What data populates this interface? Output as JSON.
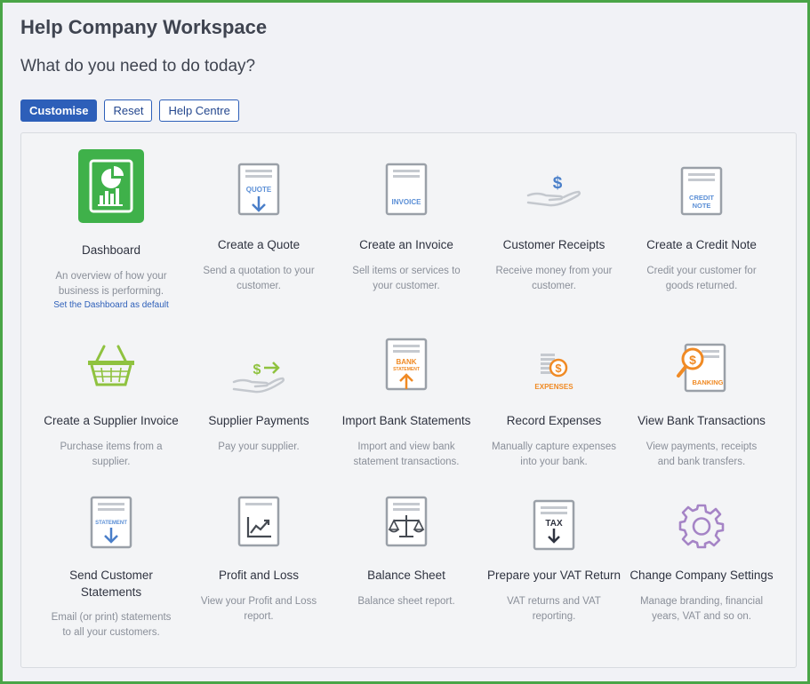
{
  "header": {
    "title": "Help Company Workspace",
    "subtitle": "What do you need to do today?"
  },
  "toolbar": {
    "customise": "Customise",
    "reset": "Reset",
    "help_centre": "Help Centre"
  },
  "colors": {
    "accent": "#2d5fb9",
    "brand_green": "#3fb14a",
    "icon_grey": "#6c6f77",
    "icon_blue": "#5b8fd6",
    "icon_orange": "#f08a24",
    "icon_lime": "#8fc23f",
    "icon_purple": "#a584c6"
  },
  "tiles": [
    {
      "label": "Dashboard",
      "desc": "An overview of how your business is performing.",
      "link": "Set the Dashboard as default",
      "icon": "dashboard-icon"
    },
    {
      "label": "Create a Quote",
      "desc": "Send a quotation to your customer.",
      "icon": "quote-icon",
      "icon_text": "QUOTE"
    },
    {
      "label": "Create an Invoice",
      "desc": "Sell items or services to your customer.",
      "icon": "invoice-icon",
      "icon_text": "INVOICE"
    },
    {
      "label": "Customer Receipts",
      "desc": "Receive money from your customer.",
      "icon": "customer-receipt-icon",
      "icon_text": "$"
    },
    {
      "label": "Create a Credit Note",
      "desc": "Credit your customer for goods returned.",
      "icon": "credit-note-icon",
      "icon_text": "CREDIT NOTE"
    },
    {
      "label": "Create a Supplier Invoice",
      "desc": "Purchase items from a supplier.",
      "icon": "basket-icon"
    },
    {
      "label": "Supplier Payments",
      "desc": "Pay your supplier.",
      "icon": "supplier-payment-icon",
      "icon_text": "$"
    },
    {
      "label": "Import Bank Statements",
      "desc": "Import and view bank statement transactions.",
      "icon": "bank-statement-icon",
      "icon_text": "BANK",
      "icon_text2": "STATEMENT"
    },
    {
      "label": "Record Expenses",
      "desc": "Manually capture expenses into your bank.",
      "icon": "expenses-icon",
      "icon_text": "EXPENSES"
    },
    {
      "label": "View Bank Transactions",
      "desc": "View payments, receipts and bank transfers.",
      "icon": "banking-icon",
      "icon_text": "BANKING"
    },
    {
      "label": "Send Customer Statements",
      "desc": "Email (or print) statements to all your customers.",
      "icon": "statement-icon",
      "icon_text": "STATEMENT"
    },
    {
      "label": "Profit and Loss",
      "desc": "View your Profit and Loss report.",
      "icon": "profit-loss-icon"
    },
    {
      "label": "Balance Sheet",
      "desc": "Balance sheet report.",
      "icon": "balance-sheet-icon"
    },
    {
      "label": "Prepare your VAT Return",
      "desc": "VAT returns and VAT reporting.",
      "icon": "vat-return-icon",
      "icon_text": "TAX"
    },
    {
      "label": "Change Company Settings",
      "desc": "Manage branding, financial years, VAT and so on.",
      "icon": "settings-gear-icon"
    }
  ]
}
